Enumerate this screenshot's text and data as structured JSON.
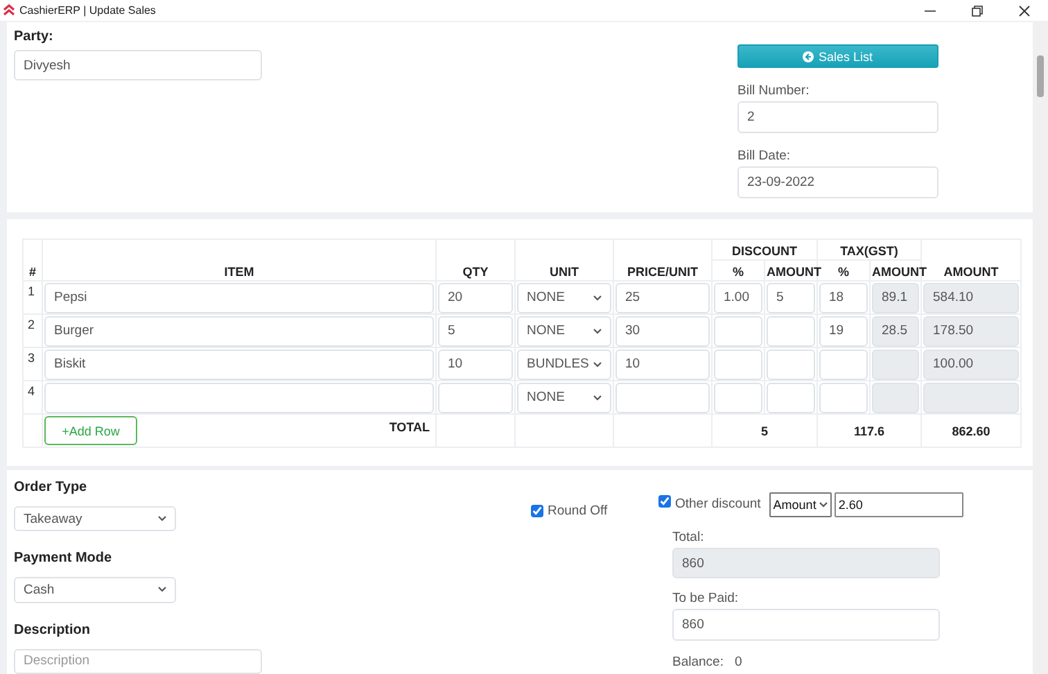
{
  "window": {
    "title": "CashierERP | Update Sales"
  },
  "party": {
    "label": "Party:",
    "value": "Divyesh"
  },
  "sales_list_button": {
    "label": "Sales List"
  },
  "bill_number": {
    "label": "Bill Number:",
    "value": "2"
  },
  "bill_date": {
    "label": "Bill Date:",
    "value": "23-09-2022"
  },
  "items_table": {
    "header": {
      "number": "#",
      "item": "ITEM",
      "qty": "QTY",
      "unit": "UNIT",
      "price": "PRICE/UNIT",
      "discount": {
        "label": "DISCOUNT",
        "percent": "%",
        "amount": "AMOUNT"
      },
      "tax": {
        "label": "TAX(GST)",
        "percent": "%",
        "amount": "AMOUNT"
      },
      "amount": "AMOUNT"
    },
    "rows": [
      {
        "number": "1",
        "item": "Pepsi",
        "qty": "20",
        "unit": "NONE",
        "price": "25",
        "discount_percent": "1.00",
        "discount_amount": "5",
        "tax_percent": "18",
        "tax_amount": "89.1",
        "amount": "584.10"
      },
      {
        "number": "2",
        "item": "Burger",
        "qty": "5",
        "unit": "NONE",
        "price": "30",
        "tax_percent": "19",
        "tax_amount": "28.5",
        "amount": "178.50"
      },
      {
        "number": "3",
        "item": "Biskit",
        "qty": "10",
        "unit": "BUNDLES",
        "price": "10",
        "amount": "100.00"
      },
      {
        "number": "4",
        "unit": "NONE"
      }
    ],
    "add_row_button": "+Add Row",
    "total": {
      "label": "TOTAL",
      "discount": "5",
      "tax": "117.6",
      "amount": "862.60"
    }
  },
  "order_type": {
    "label": "Order Type",
    "value": "Takeaway"
  },
  "payment_mode": {
    "label": "Payment Mode",
    "value": "Cash"
  },
  "description": {
    "label": "Description",
    "placeholder": "Description"
  },
  "round_off": {
    "label": "Round Off",
    "checked": true
  },
  "other_discount": {
    "label": "Other discount",
    "checked": true,
    "mode": "Amount",
    "value": "2.60"
  },
  "total": {
    "label": "Total:",
    "value": "860"
  },
  "to_be_paid": {
    "label": "To be Paid:",
    "value": "860"
  },
  "balance": {
    "label": "Balance:",
    "value": "0"
  }
}
